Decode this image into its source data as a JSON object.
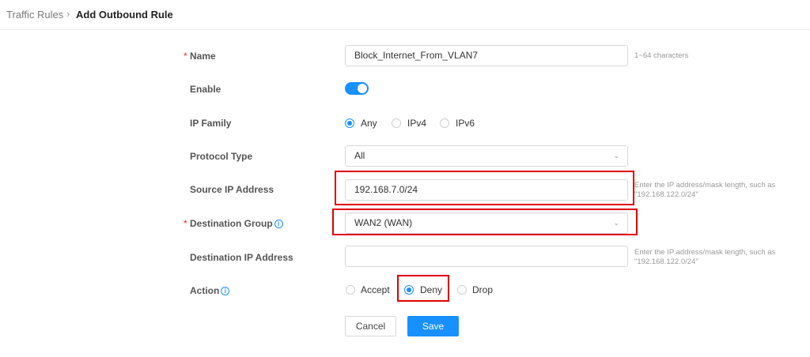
{
  "breadcrumb": {
    "parent": "Traffic Rules",
    "separator": "›",
    "current": "Add Outbound Rule"
  },
  "form": {
    "name": {
      "label": "Name",
      "required_mark": "*",
      "value": "Block_Internet_From_VLAN7",
      "hint": "1~64 characters"
    },
    "enable": {
      "label": "Enable",
      "on": true
    },
    "ip_family": {
      "label": "IP Family",
      "options": [
        "Any",
        "IPv4",
        "IPv6"
      ],
      "selected": "Any"
    },
    "protocol_type": {
      "label": "Protocol Type",
      "value": "All"
    },
    "source_ip": {
      "label": "Source IP Address",
      "value": "192.168.7.0/24",
      "hint": "Enter the IP address/mask length, such as \"192.168.122.0/24\""
    },
    "destination_group": {
      "label": "Destination Group",
      "required_mark": "*",
      "value": "WAN2 (WAN)"
    },
    "destination_ip": {
      "label": "Destination IP Address",
      "value": "",
      "hint": "Enter the IP address/mask length, such as \"192.168.122.0/24\""
    },
    "action": {
      "label": "Action",
      "options": [
        "Accept",
        "Deny",
        "Drop"
      ],
      "selected": "Deny"
    }
  },
  "buttons": {
    "cancel": "Cancel",
    "save": "Save"
  },
  "icons": {
    "info": "info-circle-icon",
    "dropdown": "chevron-down-icon"
  },
  "colors": {
    "accent": "#1890ff",
    "highlight": "#e00000",
    "required": "#f5222d"
  }
}
